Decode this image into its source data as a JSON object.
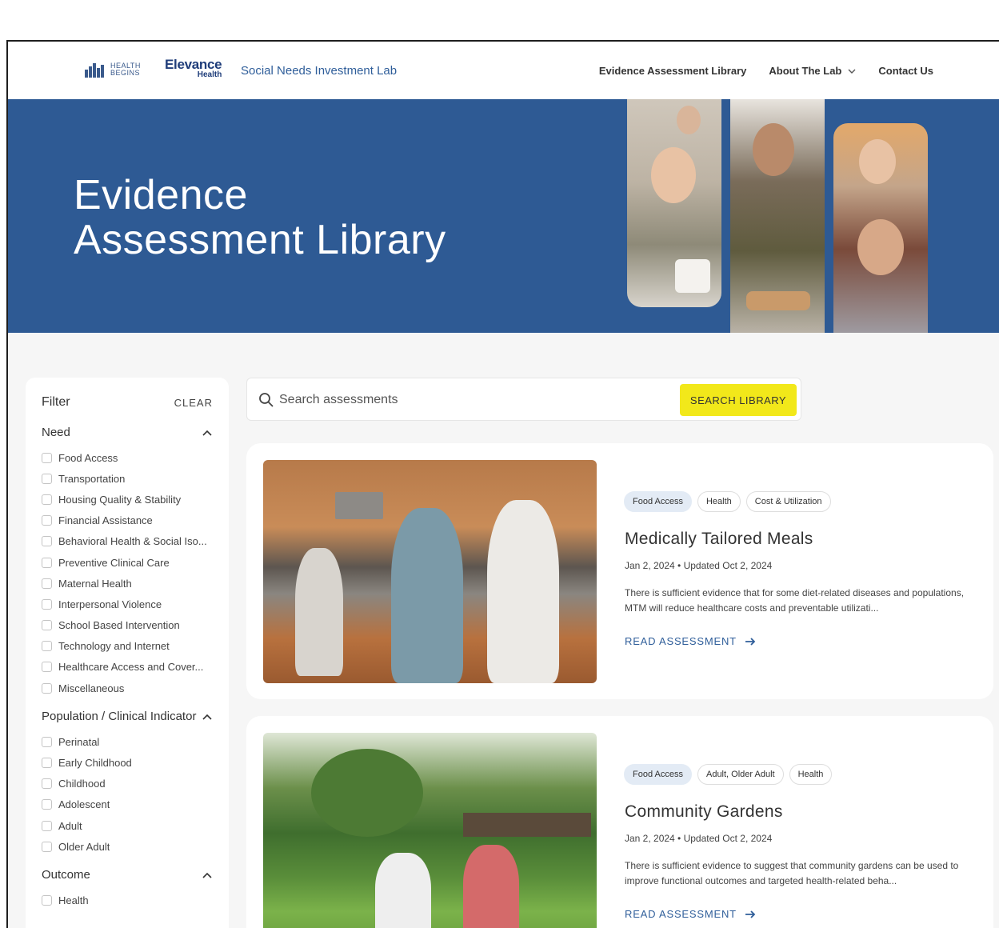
{
  "header": {
    "health_begins_logo": "HEALTH BEGINS",
    "elevance_main": "Elevance",
    "elevance_sub": "Health",
    "lab_name": "Social Needs Investment Lab",
    "nav": {
      "library": "Evidence Assessment Library",
      "about": "About The Lab",
      "contact": "Contact Us"
    }
  },
  "hero": {
    "title_line1": "Evidence",
    "title_line2": "Assessment Library"
  },
  "filter": {
    "title": "Filter",
    "clear": "CLEAR",
    "groups": [
      {
        "title": "Need",
        "options": [
          "Food Access",
          "Transportation",
          "Housing Quality & Stability",
          "Financial Assistance",
          "Behavioral Health & Social Iso...",
          "Preventive Clinical Care",
          "Maternal Health",
          "Interpersonal Violence",
          "School Based Intervention",
          "Technology and Internet",
          "Healthcare Access and Cover...",
          "Miscellaneous"
        ]
      },
      {
        "title": "Population / Clinical Indicator",
        "options": [
          "Perinatal",
          "Early Childhood",
          "Childhood",
          "Adolescent",
          "Adult",
          "Older Adult"
        ]
      },
      {
        "title": "Outcome",
        "options": [
          "Health"
        ]
      }
    ]
  },
  "search": {
    "placeholder": "Search assessments",
    "button": "SEARCH LIBRARY"
  },
  "cards": [
    {
      "tags": [
        "Food Access",
        "Health",
        "Cost & Utilization"
      ],
      "title": "Medically Tailored Meals",
      "date": "Jan 2, 2024 • Updated Oct 2, 2024",
      "description": "There is sufficient evidence that for some diet-related diseases and populations, MTM will reduce healthcare costs and preventable utilizati...",
      "link": "READ ASSESSMENT"
    },
    {
      "tags": [
        "Food Access",
        "Adult, Older Adult",
        "Health"
      ],
      "title": "Community Gardens",
      "date": "Jan 2, 2024 • Updated Oct 2, 2024",
      "description": "There is sufficient evidence to suggest that community gardens can be used to improve functional outcomes and targeted health-related beha...",
      "link": "READ ASSESSMENT"
    }
  ],
  "colors": {
    "hero_bg": "#2e5a94",
    "accent_yellow": "#f2e81a",
    "link_blue": "#2f5e9a",
    "tag_primary_bg": "#e3ebf5"
  },
  "icons": [
    "search-icon",
    "chevron-down-icon",
    "chevron-up-icon",
    "arrow-right-icon",
    "checkbox-icon"
  ]
}
